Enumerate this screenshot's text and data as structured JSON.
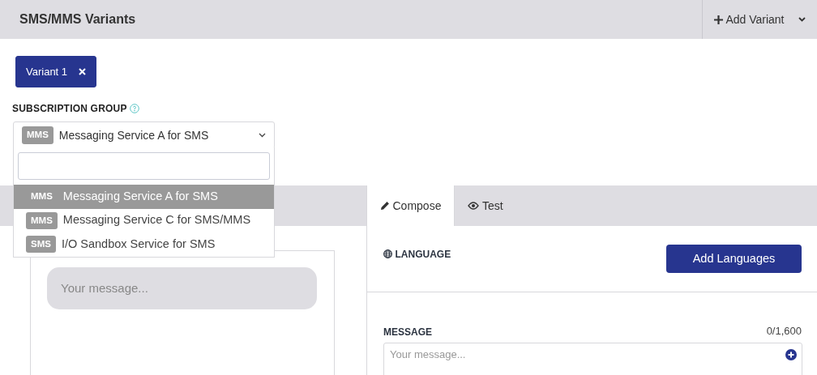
{
  "header": {
    "title": "SMS/MMS Variants",
    "add_button": "Add Variant"
  },
  "variants": [
    {
      "label": "Variant 1",
      "selected": true
    }
  ],
  "subscription_group": {
    "label": "SUBSCRIPTION GROUP",
    "selected_tag": "MMS",
    "selected_value": "Messaging Service A for SMS",
    "expanded": true,
    "options": [
      {
        "tag": "MMS",
        "label": "Messaging Service A for SMS",
        "selected": true
      },
      {
        "tag": "MMS",
        "label": "Messaging Service C for SMS/MMS",
        "selected": false
      },
      {
        "tag": "SMS",
        "label": "I/O Sandbox Service for SMS",
        "selected": false
      }
    ]
  },
  "tabs": [
    {
      "label": "Compose",
      "selected": true
    },
    {
      "label": "Test",
      "selected": false
    }
  ],
  "preview": {
    "bubble_text": "Your message..."
  },
  "language": {
    "label": "LANGUAGE",
    "button": "Add Languages"
  },
  "message": {
    "label": "MESSAGE",
    "counter": "0/1,600",
    "placeholder": "Your message..."
  }
}
